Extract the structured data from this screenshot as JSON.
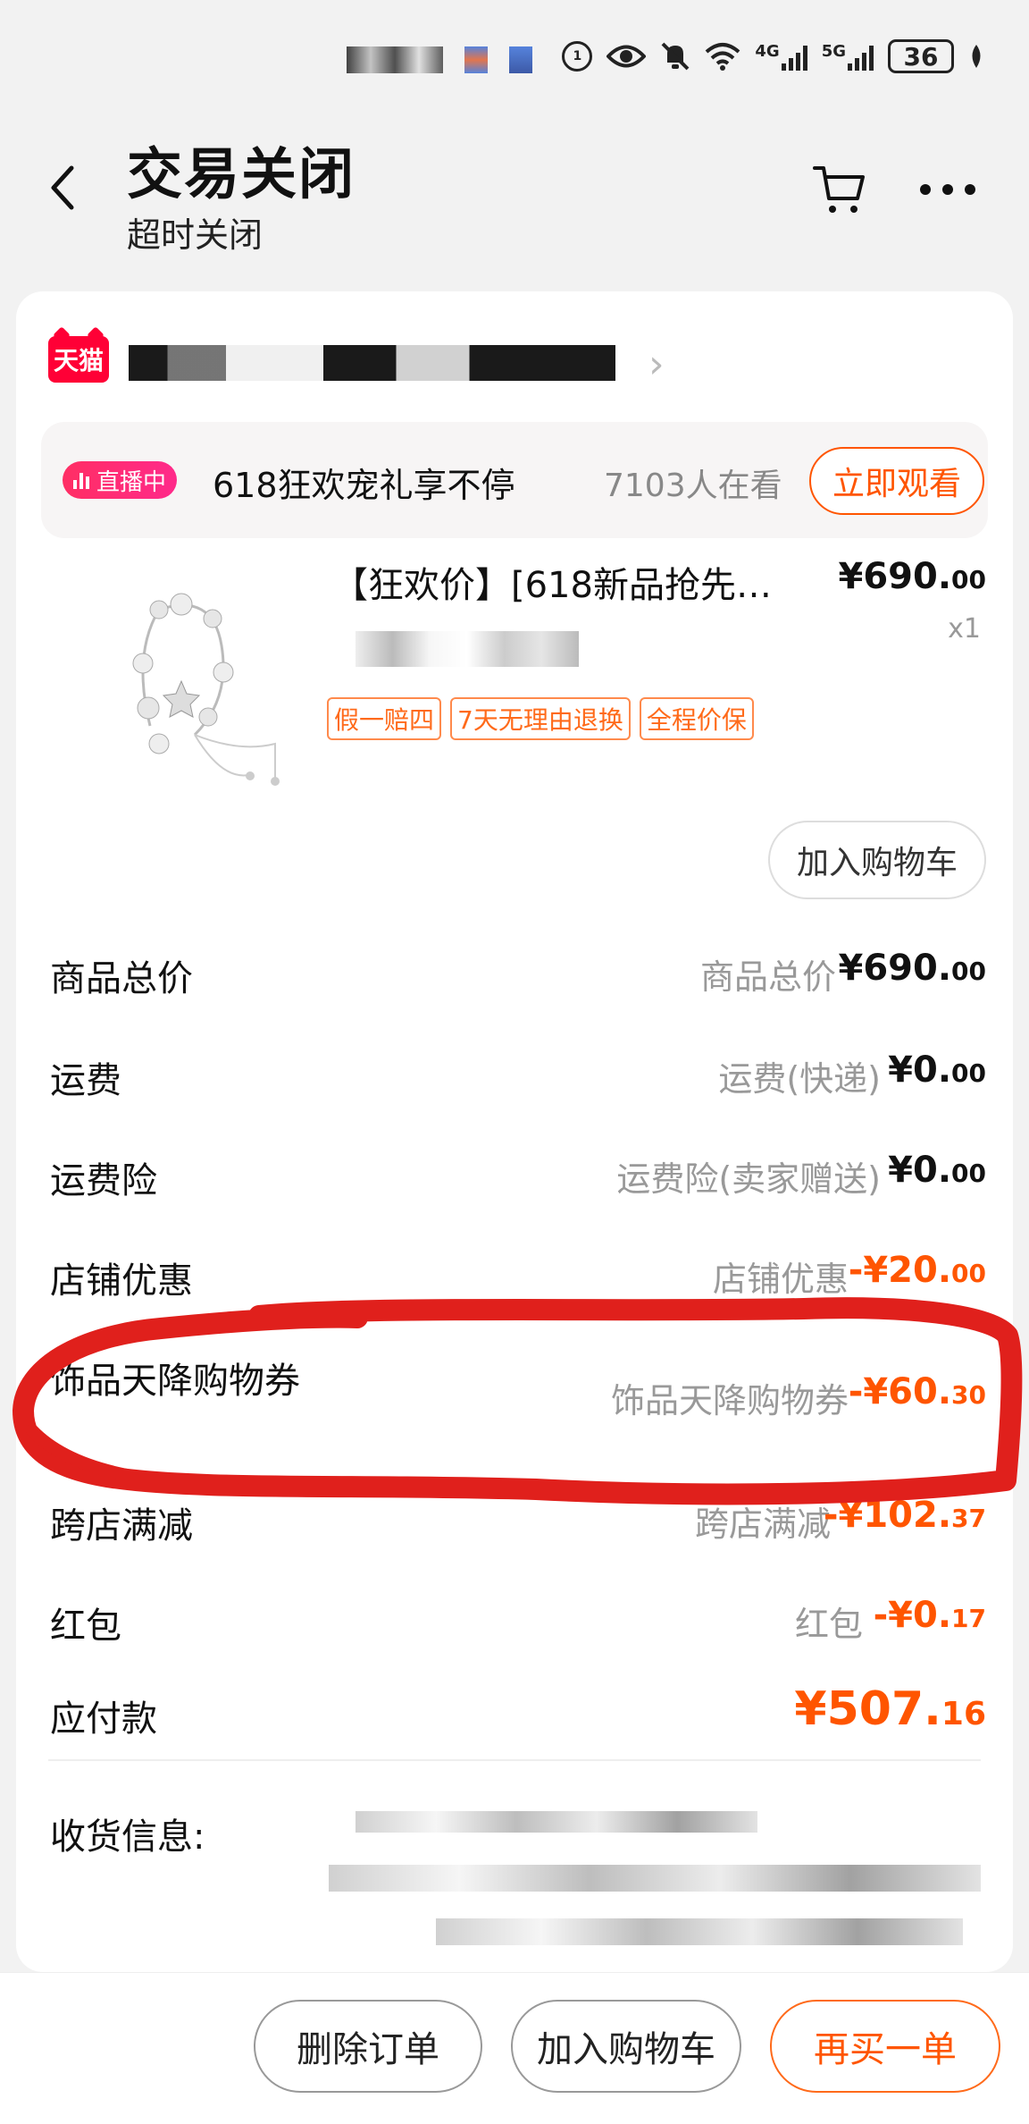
{
  "status_bar": {
    "network_4g": "4G",
    "network_5g": "5G",
    "battery": "36"
  },
  "header": {
    "title": "交易关闭",
    "subtitle": "超时关闭"
  },
  "store": {
    "logo_text": "天猫"
  },
  "live": {
    "badge": "直播中",
    "text": "618狂欢宠礼享不停",
    "viewers": "7103人在看",
    "watch_label": "立即观看"
  },
  "product": {
    "title": "【狂欢价】[618新品抢先…",
    "price_main": "¥690.",
    "price_cents": "00",
    "quantity": "x1",
    "tags": [
      "假一赔四",
      "7天无理由退换",
      "全程价保"
    ],
    "add_cart_label": "加入购物车"
  },
  "fees": [
    {
      "label": "商品总价",
      "sub": "商品总价",
      "main": "¥690.",
      "cents": "00",
      "highlight": false
    },
    {
      "label": "运费",
      "sub": "运费(快递)",
      "main": "¥0.",
      "cents": "00",
      "highlight": false
    },
    {
      "label": "运费险",
      "sub": "运费险(卖家赠送)",
      "main": "¥0.",
      "cents": "00",
      "highlight": false
    },
    {
      "label": "店铺优惠",
      "sub": "店铺优惠",
      "main": "-¥20.",
      "cents": "00",
      "highlight": true
    },
    {
      "label": "饰品天降购物券",
      "sub": "饰品天降购物券",
      "main": "-¥60.",
      "cents": "30",
      "highlight": true
    },
    {
      "label": "跨店满减",
      "sub": "跨店满减",
      "main": "-¥102.",
      "cents": "37",
      "highlight": true
    },
    {
      "label": "红包",
      "sub": "红包",
      "main": "-¥0.",
      "cents": "17",
      "highlight": true
    }
  ],
  "total": {
    "label": "应付款",
    "main": "¥507.",
    "cents": "16"
  },
  "address": {
    "label": "收货信息:"
  },
  "bottom_bar": {
    "delete_label": "删除订单",
    "add_cart_label": "加入购物车",
    "rebuy_label": "再买一单"
  },
  "colors": {
    "accent": "#ff5500",
    "live": "#ff2e64",
    "tmall": "#ff0036",
    "annotation": "#e0201c"
  }
}
